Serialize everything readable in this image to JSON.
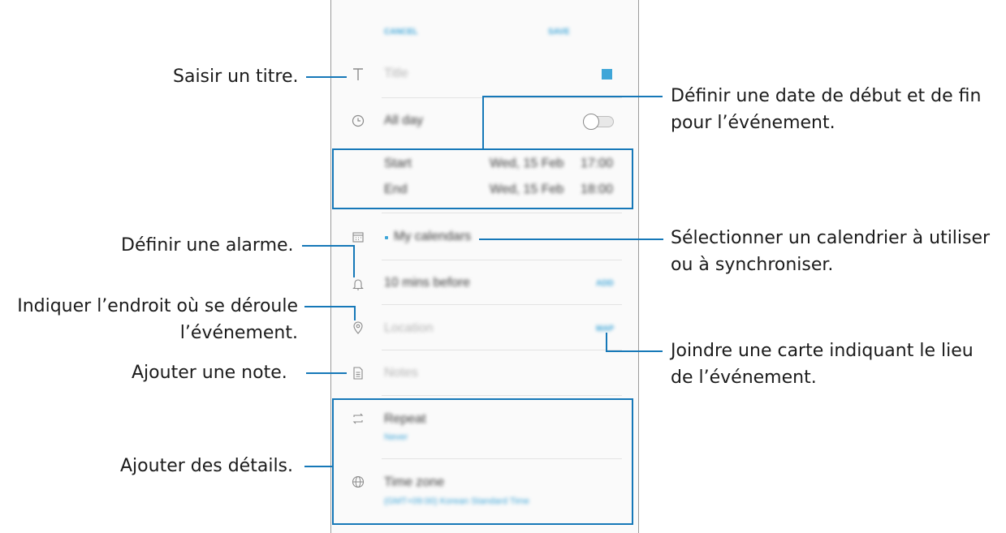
{
  "header": {
    "cancel_label": "CANCEL",
    "save_label": "SAVE"
  },
  "form": {
    "title_placeholder": "Title",
    "title_color": "#3fa6d8",
    "all_day_label": "All day",
    "all_day_on": false,
    "start_label": "Start",
    "start_date": "Wed, 15 Feb",
    "start_time": "17:00",
    "end_label": "End",
    "end_date": "Wed, 15 Feb",
    "end_time": "18:00",
    "calendar_label": "My calendars",
    "reminder_label": "10 mins before",
    "reminder_action": "ADD",
    "location_placeholder": "Location",
    "location_action": "MAP",
    "notes_placeholder": "Notes",
    "repeat_label": "Repeat",
    "repeat_value": "Never",
    "timezone_label": "Time zone",
    "timezone_value": "(GMT+09:00) Korean Standard Time"
  },
  "annotations": {
    "title": "Saisir un titre.",
    "dates_line1": "Définir une date de début et de fin",
    "dates_line2": "pour l’événement.",
    "alarm": "Définir une alarme.",
    "calendar_line1": "Sélectionner un calendrier à utiliser",
    "calendar_line2": "ou à synchroniser.",
    "location_line1": "Indiquer l’endroit où se déroule",
    "location_line2": "l’événement.",
    "map_line1": "Joindre une carte indiquant le lieu",
    "map_line2": "de l’événement.",
    "note": "Ajouter une note.",
    "details": "Ajouter des détails."
  },
  "colors": {
    "accent": "#3fa6d8",
    "callout": "#1678b8"
  },
  "icons": [
    "text-icon",
    "clock-icon",
    "calendar-icon",
    "bell-icon",
    "location-pin-icon",
    "note-icon",
    "repeat-icon",
    "globe-icon"
  ]
}
